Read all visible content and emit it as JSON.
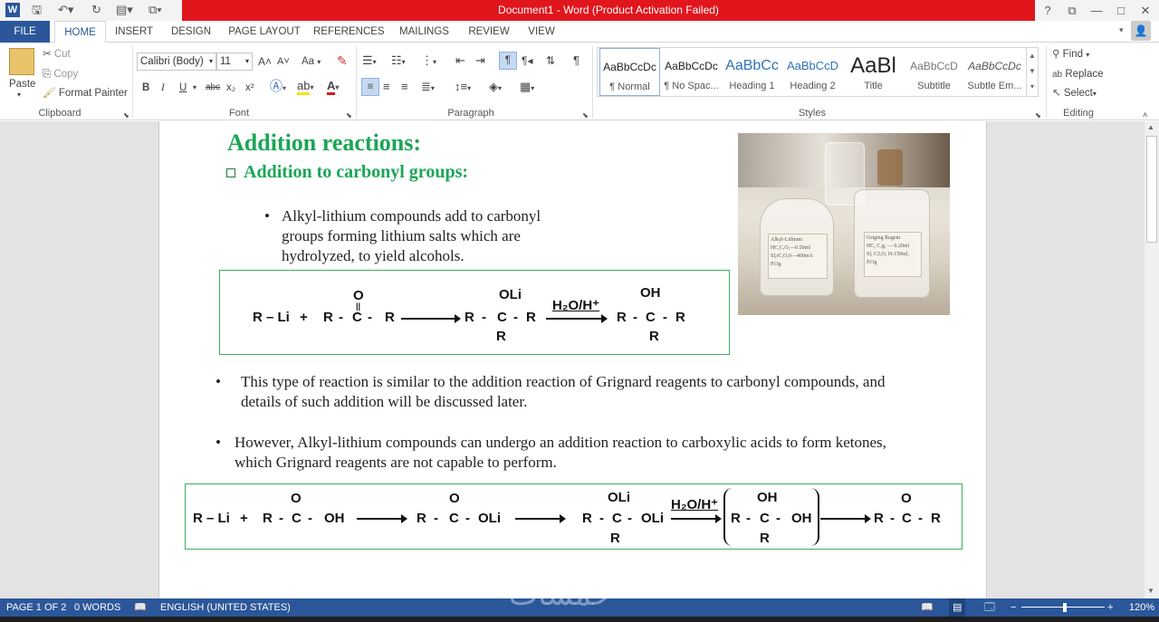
{
  "window": {
    "title": "Document1 -  Word (Product Activation Failed)",
    "help": "?",
    "restore": "⧉",
    "minimize": "—",
    "maximize": "□",
    "close": "✕"
  },
  "qat": {
    "save_icon": "save-icon",
    "undo_icon": "undo-icon",
    "redo_icon": "redo-icon"
  },
  "tabs": [
    "FILE",
    "HOME",
    "INSERT",
    "DESIGN",
    "PAGE LAYOUT",
    "REFERENCES",
    "MAILINGS",
    "REVIEW",
    "VIEW"
  ],
  "clipboard": {
    "paste": "Paste",
    "cut": "Cut",
    "copy": "Copy",
    "format_painter": "Format Painter",
    "label": "Clipboard"
  },
  "font": {
    "name": "Calibri (Body)",
    "size": "11",
    "label": "Font",
    "bold": "B",
    "italic": "I",
    "underline": "U",
    "strike": "abc",
    "sub": "x₂",
    "sup": "x²",
    "grow": "A˄",
    "shrink": "A˅",
    "case": "Aa",
    "clear": "A"
  },
  "paragraph": {
    "label": "Paragraph"
  },
  "styles": {
    "label": "Styles",
    "items": [
      {
        "preview": "AaBbCcDc",
        "name": "¶ Normal"
      },
      {
        "preview": "AaBbCcDc",
        "name": "¶ No Spac..."
      },
      {
        "preview": "AaBbCc",
        "name": "Heading 1"
      },
      {
        "preview": "AaBbCcD",
        "name": "Heading 2"
      },
      {
        "preview": "AaBl",
        "name": "Title"
      },
      {
        "preview": "AaBbCcD",
        "name": "Subtitle"
      },
      {
        "preview": "AaBbCcDc",
        "name": "Subtle Em..."
      }
    ]
  },
  "editing": {
    "find": "Find",
    "replace": "Replace",
    "select": "Select",
    "label": "Editing"
  },
  "doc": {
    "heading1": "Addition reactions:",
    "heading2": "Addition to carbonyl groups:",
    "bullet1": [
      "Alkyl-lithium compounds add to carbonyl",
      "groups forming lithium salts which are",
      "hydrolyzed, to yield alcohols."
    ],
    "bullet2": [
      "This type of reaction is similar to the addition reaction of Grignard reagents to carbonyl compounds, and",
      "details of such addition will be discussed later."
    ],
    "bullet3": [
      "However, Alkyl-lithium compounds can undergo an addition reaction to carboxylic acids to form ketones,",
      "which Grignard reagents are not capable to perform."
    ],
    "photo_labels": {
      "left": [
        "Alkyl-Lithium",
        "HC,C,O,—0.50ml",
        "Sl,rC,O,0—400mA",
        "P.Og"
      ],
      "right": [
        "Griging Regent",
        "HC, C,g, — 0.20ml",
        "Sl, C2,O, H-150ml,",
        "P.Og"
      ]
    },
    "rxn1": {
      "rli": "R – Li",
      "plus": "+",
      "r": "R",
      "dash": "-",
      "c": "C",
      "o": "O",
      "oli": "OLi",
      "oh": "OH",
      "reagent": "H₂O/H⁺"
    },
    "rxn2": {
      "oh_acid": "OH",
      "oli": "OLi",
      "r_ketone": "R"
    }
  },
  "status": {
    "page": "PAGE 1 OF 2",
    "words": "0 WORDS",
    "language": "ENGLISH (UNITED STATES)",
    "zoom": "120%",
    "watermark": "خمسات"
  }
}
